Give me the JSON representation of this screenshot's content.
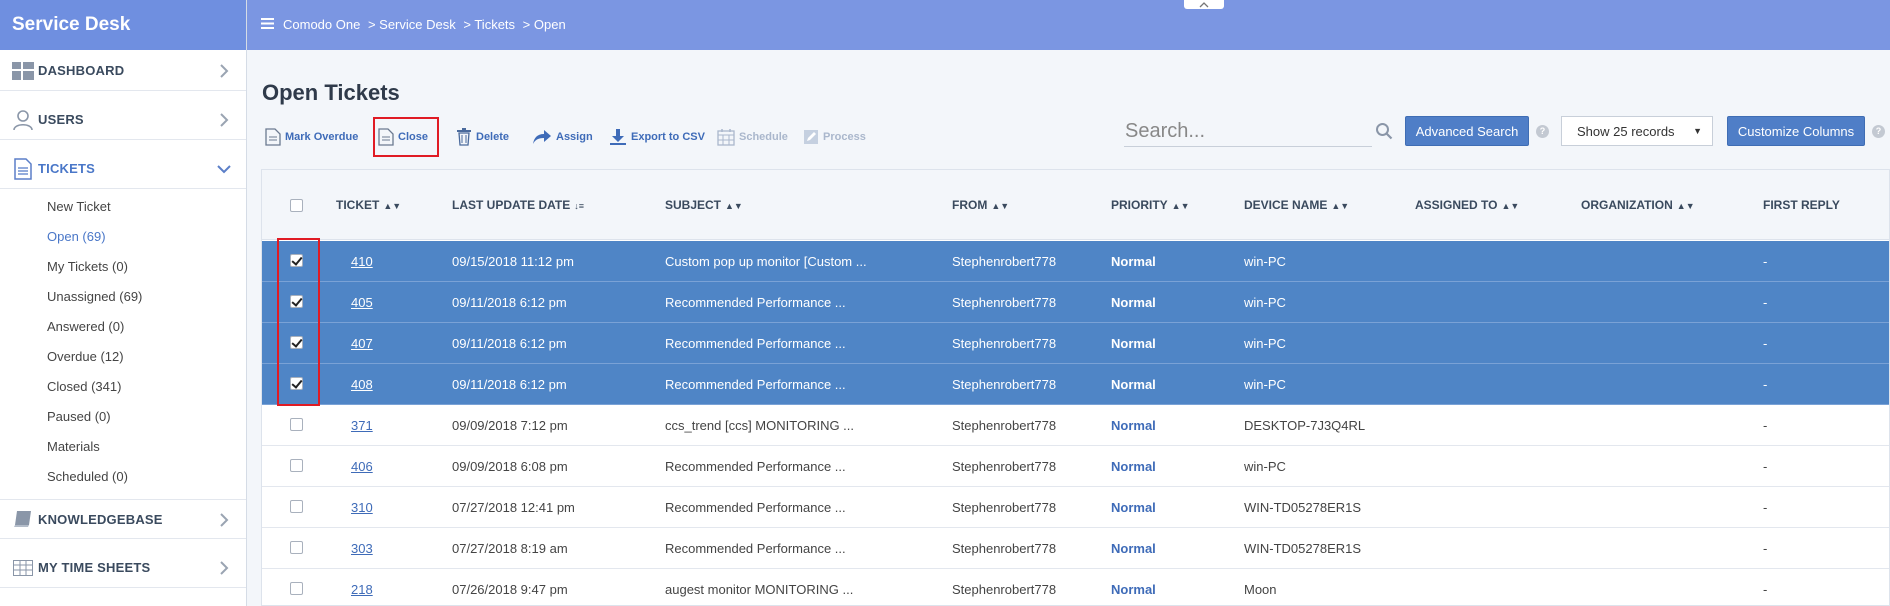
{
  "sidebar": {
    "brand": "Service Desk",
    "nav": [
      {
        "label": "DASHBOARD",
        "icon": "dashboard-grid-icon"
      },
      {
        "label": "USERS",
        "icon": "user-icon"
      },
      {
        "label": "TICKETS",
        "icon": "document-icon"
      },
      {
        "label": "KNOWLEDGEBASE",
        "icon": "book-icon"
      },
      {
        "label": "MY TIME SHEETS",
        "icon": "table-icon"
      }
    ],
    "ticket_sub": [
      "New Ticket",
      "Open (69)",
      "My Tickets (0)",
      "Unassigned (69)",
      "Answered (0)",
      "Overdue (12)",
      "Closed (341)",
      "Paused (0)",
      "Materials",
      "Scheduled (0)"
    ]
  },
  "topbar": {
    "breadcrumb": [
      "Comodo One",
      "> Service Desk",
      "> Tickets",
      "> Open"
    ]
  },
  "page": {
    "title": "Open Tickets"
  },
  "toolbar": {
    "mark_overdue": "Mark Overdue",
    "close": "Close",
    "delete": "Delete",
    "assign": "Assign",
    "export": "Export to CSV",
    "schedule": "Schedule",
    "process": "Process"
  },
  "search": {
    "placeholder": "Search...",
    "advanced_label": "Advanced Search",
    "records_label": "Show 25 records",
    "customize_label": "Customize Columns",
    "help": "?"
  },
  "table": {
    "headers": {
      "ticket": "TICKET",
      "last_update": "LAST UPDATE DATE",
      "subject": "SUBJECT",
      "from": "FROM",
      "priority": "PRIORITY",
      "device": "DEVICE NAME",
      "assigned": "ASSIGNED TO",
      "org": "ORGANIZATION",
      "first_reply": "FIRST REPLY"
    },
    "rows": [
      {
        "ticket": "410",
        "date": "09/15/2018 11:12 pm",
        "subject": "Custom pop up monitor [Custom ...",
        "from": "Stephenrobert778",
        "priority": "Normal",
        "device": "win-PC",
        "first_reply": "-",
        "selected": true
      },
      {
        "ticket": "405",
        "date": "09/11/2018 6:12 pm",
        "subject": "Recommended Performance ...",
        "from": "Stephenrobert778",
        "priority": "Normal",
        "device": "win-PC",
        "first_reply": "-",
        "selected": true
      },
      {
        "ticket": "407",
        "date": "09/11/2018 6:12 pm",
        "subject": "Recommended Performance ...",
        "from": "Stephenrobert778",
        "priority": "Normal",
        "device": "win-PC",
        "first_reply": "-",
        "selected": true
      },
      {
        "ticket": "408",
        "date": "09/11/2018 6:12 pm",
        "subject": "Recommended Performance ...",
        "from": "Stephenrobert778",
        "priority": "Normal",
        "device": "win-PC",
        "first_reply": "-",
        "selected": true
      },
      {
        "ticket": "371",
        "date": "09/09/2018 7:12 pm",
        "subject": "ccs_trend [ccs] MONITORING ...",
        "from": "Stephenrobert778",
        "priority": "Normal",
        "device": "DESKTOP-7J3Q4RL",
        "first_reply": "-",
        "selected": false
      },
      {
        "ticket": "406",
        "date": "09/09/2018 6:08 pm",
        "subject": "Recommended Performance ...",
        "from": "Stephenrobert778",
        "priority": "Normal",
        "device": "win-PC",
        "first_reply": "-",
        "selected": false
      },
      {
        "ticket": "310",
        "date": "07/27/2018 12:41 pm",
        "subject": "Recommended Performance ...",
        "from": "Stephenrobert778",
        "priority": "Normal",
        "device": "WIN-TD05278ER1S",
        "first_reply": "-",
        "selected": false
      },
      {
        "ticket": "303",
        "date": "07/27/2018 8:19 am",
        "subject": "Recommended Performance ...",
        "from": "Stephenrobert778",
        "priority": "Normal",
        "device": "WIN-TD05278ER1S",
        "first_reply": "-",
        "selected": false
      },
      {
        "ticket": "218",
        "date": "07/26/2018 9:47 pm",
        "subject": "augest monitor MONITORING ...",
        "from": "Stephenrobert778",
        "priority": "Normal",
        "device": "Moon",
        "first_reply": "-",
        "selected": false
      }
    ]
  }
}
